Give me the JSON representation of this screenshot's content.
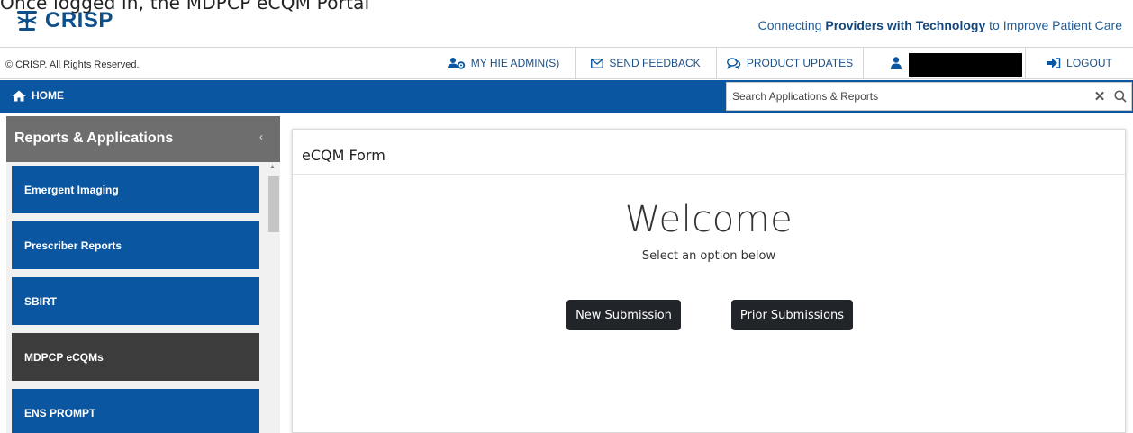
{
  "top_caption": "Once logged in, the MDPCP eCQM Portal",
  "brand": {
    "logo_text": "CRISP",
    "tagline_pre": "Connecting ",
    "tagline_bold": "Providers with Technology",
    "tagline_post": " to Improve Patient Care"
  },
  "utility": {
    "copyright": "© CRISP. All Rights Reserved.",
    "hie_admin": "MY HIE ADMIN(S)",
    "feedback": "SEND FEEDBACK",
    "updates": "PRODUCT UPDATES",
    "logout": "LOGOUT"
  },
  "nav": {
    "home": "HOME",
    "search_placeholder": "Search Applications & Reports",
    "search_clear": "✕"
  },
  "sidebar": {
    "title": "Reports & Applications",
    "collapse": "‹",
    "items": [
      {
        "label": "Emergent Imaging"
      },
      {
        "label": "Prescriber Reports"
      },
      {
        "label": "SBIRT"
      },
      {
        "label": "MDPCP eCQMs"
      },
      {
        "label": "ENS PROMPT"
      }
    ]
  },
  "main": {
    "title": "eCQM Form",
    "welcome": "Welcome",
    "subtitle": "Select an option below",
    "new_submission": "New Submission",
    "prior_submissions": "Prior Submissions"
  },
  "colors": {
    "brand_blue": "#0a56a0",
    "active_tile": "#3c3c3c",
    "button_dark": "#212529"
  }
}
